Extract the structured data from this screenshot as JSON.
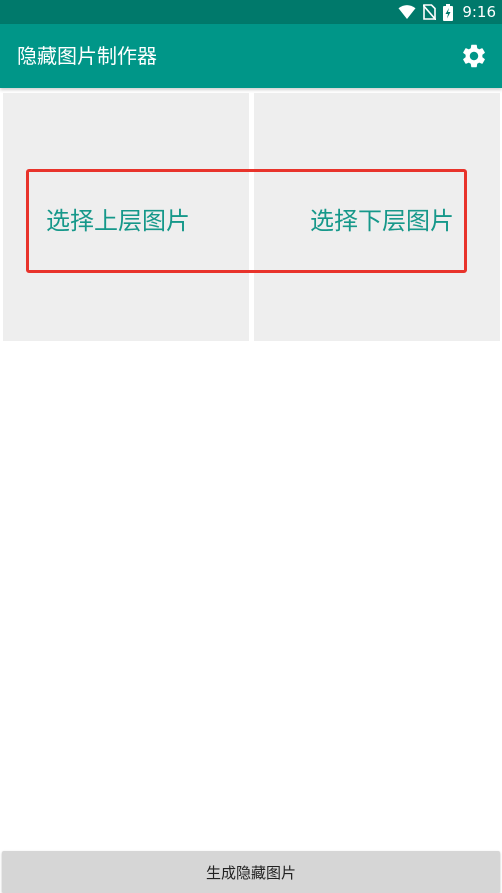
{
  "status_bar": {
    "time": "9:16",
    "icons": [
      "wifi-icon",
      "no-sim-icon",
      "battery-charging-icon"
    ],
    "background": "#00796b"
  },
  "app_bar": {
    "title": "隐藏图片制作器",
    "settings_icon": "gear-icon",
    "background": "#009688"
  },
  "tiles": {
    "top_layer_label": "选择上层图片",
    "bottom_layer_label": "选择下层图片",
    "background": "#eeeeee",
    "label_color": "#16988a"
  },
  "highlight": {
    "color": "#e8332b"
  },
  "footer": {
    "generate_label": "生成隐藏图片"
  }
}
